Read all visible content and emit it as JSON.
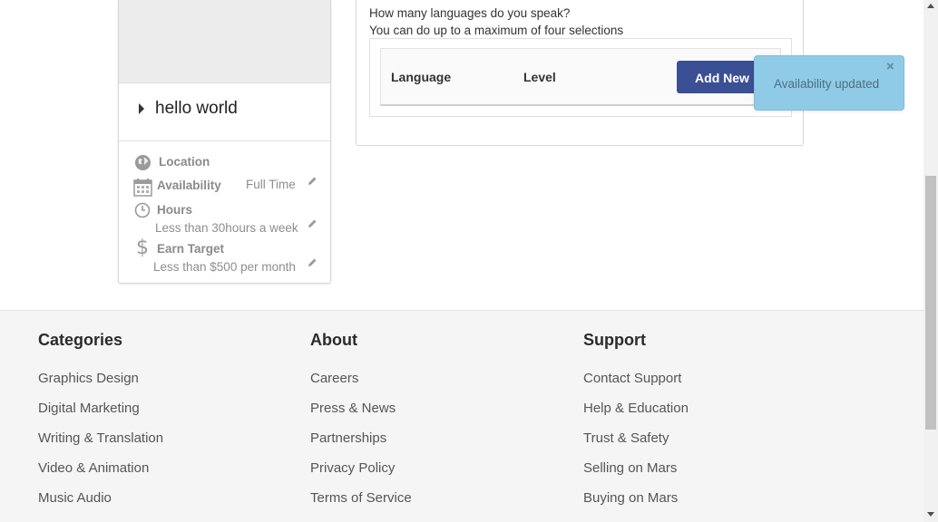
{
  "profile": {
    "name": "hello world",
    "details": [
      {
        "icon": "globe-icon",
        "label": "Location",
        "value": ""
      },
      {
        "icon": "calendar-icon",
        "label": "Availability",
        "value": "Full Time"
      },
      {
        "icon": "clock-icon",
        "label": "Hours",
        "value": "Less than 30hours a week"
      },
      {
        "icon": "dollar-icon",
        "label": "Earn Target",
        "value": "Less than $500 per month"
      }
    ]
  },
  "languages": {
    "question": "How many languages do you speak?",
    "hint": "You can do up to a maximum of four selections",
    "col_language": "Language",
    "col_level": "Level",
    "add_label": "Add New"
  },
  "toast": {
    "message": "Availability updated",
    "close": "×",
    "color": "#8fcbe6"
  },
  "footer": {
    "columns": [
      {
        "heading": "Categories",
        "links": [
          "Graphics Design",
          "Digital Marketing",
          "Writing & Translation",
          "Video & Animation",
          "Music Audio"
        ]
      },
      {
        "heading": "About",
        "links": [
          "Careers",
          "Press & News",
          "Partnerships",
          "Privacy Policy",
          "Terms of Service"
        ]
      },
      {
        "heading": "Support",
        "links": [
          "Contact Support",
          "Help & Education",
          "Trust & Safety",
          "Selling on Mars",
          "Buying on Mars"
        ]
      }
    ]
  },
  "colors": {
    "accent": "#3b4f94",
    "footer_bg": "#f5f5f5"
  }
}
